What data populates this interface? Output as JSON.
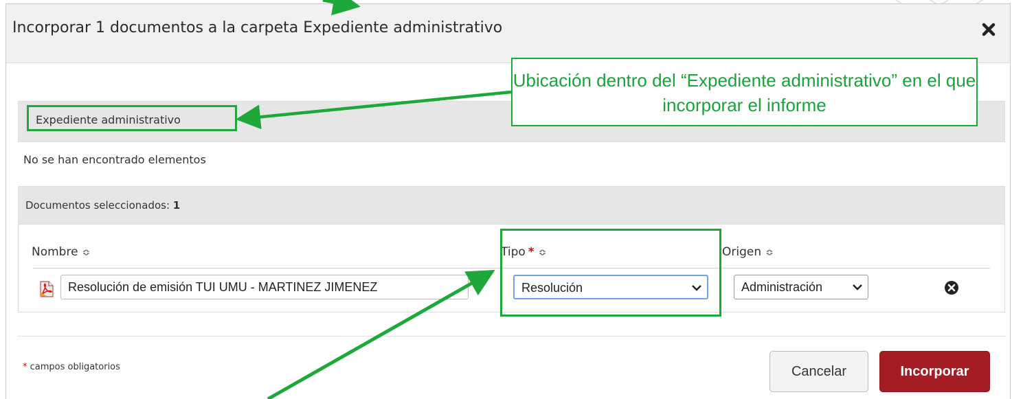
{
  "dialog": {
    "title": "Incorporar 1 documentos a la carpeta Expediente administrativo",
    "close_icon": "close-icon"
  },
  "folder": {
    "name": "Expediente administrativo",
    "empty_message": "No se han encontrado elementos"
  },
  "documents": {
    "selected_label": "Documentos seleccionados:",
    "selected_count": "1",
    "columns": {
      "name": "Nombre",
      "type": "Tipo",
      "required_mark": "*",
      "origin": "Origen"
    },
    "rows": [
      {
        "icon": "pdf-document-icon",
        "name": "Resolución de emisión TUI UMU - MARTINEZ JIMENEZ",
        "type": "Resolución",
        "origin": "Administración",
        "remove_icon": "remove-circle-icon"
      }
    ]
  },
  "footer": {
    "required_mark": "*",
    "required_note": "campos obligatorios",
    "cancel_label": "Cancelar",
    "submit_label": "Incorporar"
  },
  "annotation": {
    "callout_text": "Ubicación dentro del “Expediente administrativo” en el que incorporar el informe",
    "color": "#1fa83a"
  },
  "colors": {
    "submit_button": "#a51d24",
    "header_bg": "#f1f1f1",
    "section_bg": "#e6e6e6",
    "required_star": "#c0141b"
  }
}
